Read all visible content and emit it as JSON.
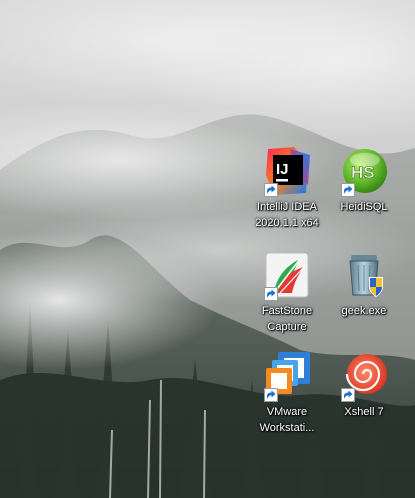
{
  "desktop": {
    "icons": [
      {
        "label": "IntelliJ IDEA\n2020.1.1 x64",
        "icon": "intellij-idea-icon"
      },
      {
        "label": "HeidiSQL",
        "icon": "heidisql-icon"
      },
      {
        "label": "FastStone\nCapture",
        "icon": "faststone-capture-icon"
      },
      {
        "label": "geek.exe",
        "icon": "geek-uninstaller-icon"
      },
      {
        "label": "VMware\nWorkstati...",
        "icon": "vmware-workstation-icon"
      },
      {
        "label": "Xshell 7",
        "icon": "xshell-icon"
      }
    ]
  },
  "colors": {
    "label_text": "#ffffff",
    "shortcut_arrow": "#1f6fd1"
  }
}
